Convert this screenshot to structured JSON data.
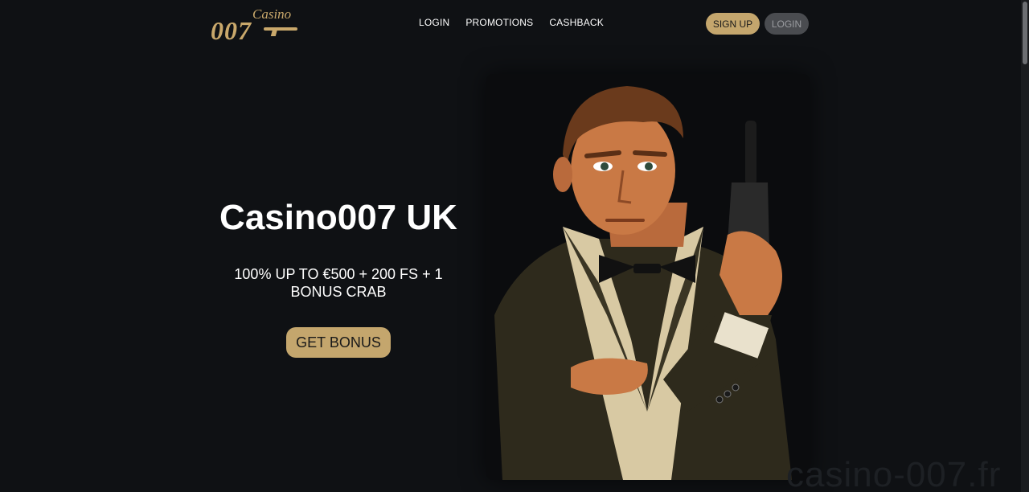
{
  "brand": {
    "logo_small": "Casino",
    "logo_number": "007"
  },
  "nav": {
    "items": [
      {
        "label": "LOGIN"
      },
      {
        "label": "PROMOTIONS"
      },
      {
        "label": "CASHBACK"
      }
    ]
  },
  "header_actions": {
    "signup_label": "SIGN UP",
    "login_label": "LOGIN"
  },
  "hero": {
    "title": "Casino007 UK",
    "offer": "100% UP TO €500 + 200 FS + 1 BONUS CRAB",
    "cta_label": "GET BONUS"
  },
  "watermark": "casino-007.fr",
  "colors": {
    "background": "#0f1114",
    "gold": "#c4a66d",
    "login_button": "#4a4c50"
  }
}
